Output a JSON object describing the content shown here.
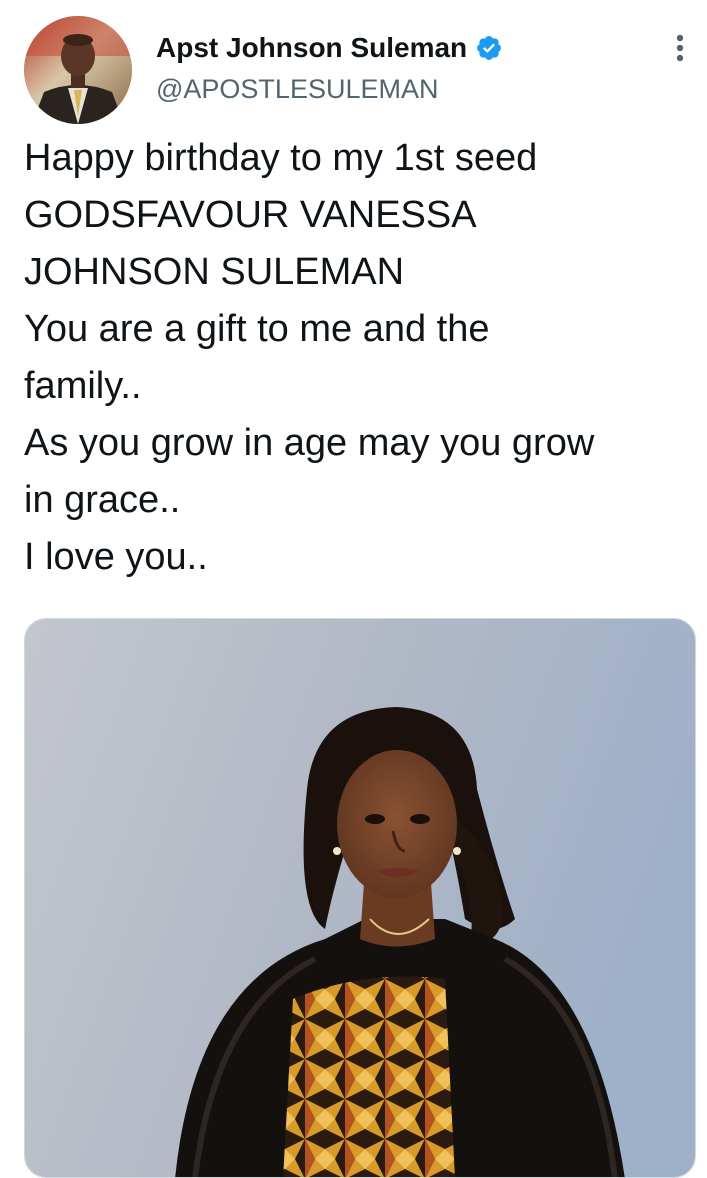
{
  "tweet": {
    "author": {
      "display_name": "Apst Johnson Suleman",
      "handle": "@APOSTLESULEMAN",
      "verified": true
    },
    "text_lines": [
      "Happy birthday to my 1st seed",
      "GODSFAVOUR VANESSA",
      "JOHNSON SULEMAN",
      "You are a gift to me and the",
      "family..",
      "As you grow in age may you grow",
      "in grace..",
      "I love you.."
    ],
    "media": {
      "type": "photo"
    }
  },
  "colors": {
    "text_primary": "#0f1419",
    "text_secondary": "#536471",
    "verified_blue": "#1d9bf0",
    "photo_background": "#a9b3c4"
  },
  "icons": {
    "verified": "verified-badge-icon",
    "more": "more-options-icon"
  }
}
